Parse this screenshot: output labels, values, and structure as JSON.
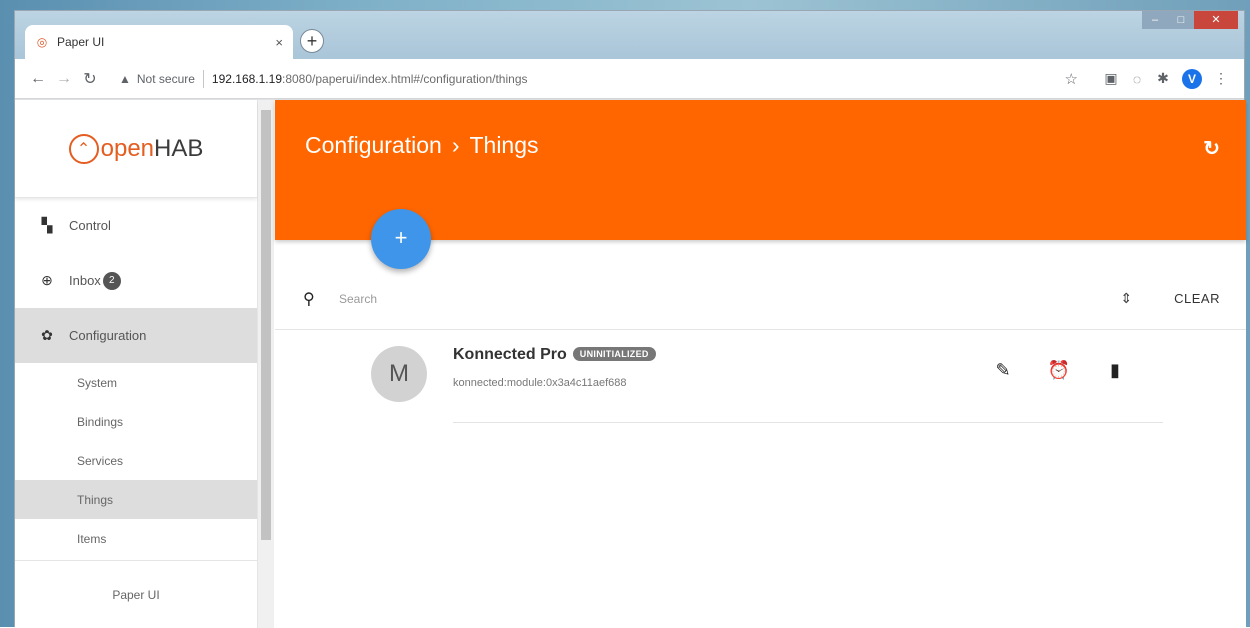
{
  "browser": {
    "tab_title": "Paper UI",
    "tab_close": "×",
    "new_tab": "+",
    "security_label": "Not secure",
    "url_host": "192.168.1.19",
    "url_rest": ":8080/paperui/index.html#/configuration/things",
    "profile_initial": "V"
  },
  "sidebar": {
    "logo_open": "open",
    "logo_hab": "HAB",
    "items": [
      {
        "label": "Control",
        "icon": "dashboard-icon"
      },
      {
        "label": "Inbox",
        "icon": "add-circle-icon",
        "badge": "2"
      },
      {
        "label": "Configuration",
        "icon": "gear-icon"
      }
    ],
    "sub_items": [
      "System",
      "Bindings",
      "Services",
      "Things",
      "Items"
    ],
    "footer": "Paper UI"
  },
  "header": {
    "crumb_parent": "Configuration",
    "crumb_separator": "›",
    "crumb_current": "Things",
    "accent_color": "#ff6600"
  },
  "search": {
    "placeholder": "Search",
    "clear_label": "CLEAR"
  },
  "things": [
    {
      "avatar_letter": "M",
      "name": "Konnected Pro",
      "status": "UNINITIALIZED",
      "uid": "konnected:module:0x3a4c11aef688"
    }
  ]
}
